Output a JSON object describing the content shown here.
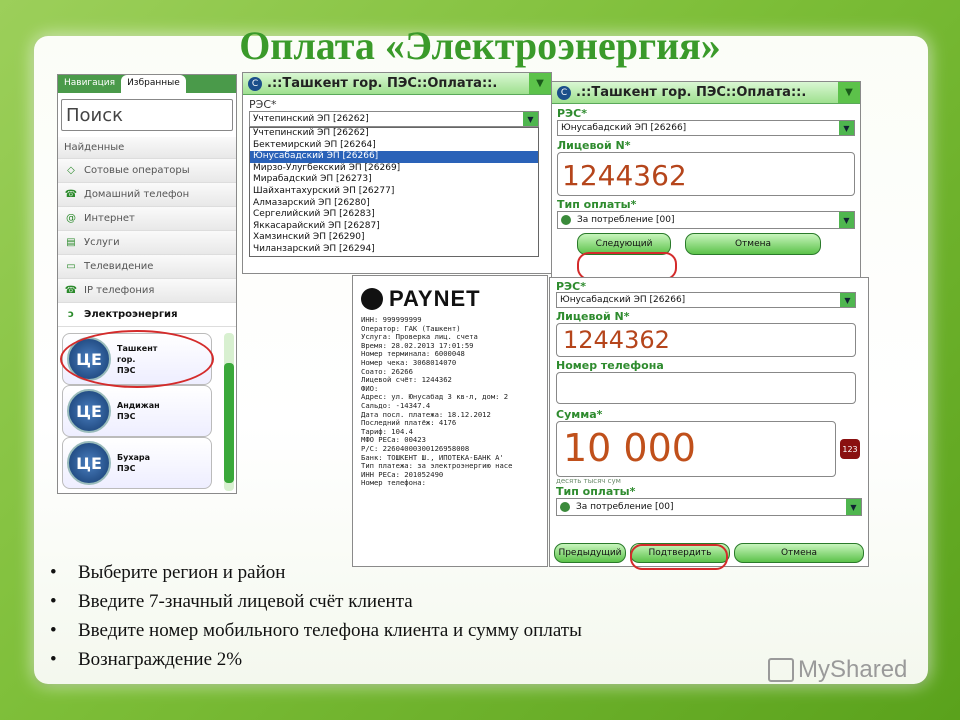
{
  "title": "Оплата «Электроэнергия»",
  "nav": {
    "tab_nav": "Навигация",
    "tab_fav": "Избранные",
    "search_placeholder": "Поиск",
    "found": "Найденные",
    "items": [
      "Сотовые операторы",
      "Домашний телефон",
      "Интернет",
      "Услуги",
      "Телевидение",
      "IP телефония",
      "Электроэнергия"
    ],
    "cards": [
      {
        "line1": "Ташкент",
        "line2": "гор.",
        "line3": "ПЭС"
      },
      {
        "line1": "Андижан",
        "line2": "ПЭС",
        "line3": ""
      },
      {
        "line1": "Бухара",
        "line2": "ПЭС",
        "line3": ""
      }
    ],
    "logo_text": "ЦЕ"
  },
  "dropdown": {
    "header": ".::Ташкент гор. ПЭС::Оплата::.",
    "label": "РЭС*",
    "selected": "Учтепинский ЭП [26262]",
    "options": [
      "Учтепинский ЭП [26262]",
      "Бектемирский ЭП [26264]",
      "Юнусабадский ЭП [26266]",
      "Мирзо-Улугбекский ЭП [26269]",
      "Мирабадский ЭП [26273]",
      "Шайхантахурский ЭП [26277]",
      "Алмазарский ЭП [26280]",
      "Сергелийский ЭП [26283]",
      "Яккасарайский ЭП [26287]",
      "Хамзинский ЭП [26290]",
      "Чиланзарский ЭП [26294]"
    ],
    "highlighted": "Юнусабадский ЭП [26266]"
  },
  "form1": {
    "header": ".::Ташкент гор. ПЭС::Оплата::.",
    "res_label": "РЭС*",
    "res_value": "Юнусабадский ЭП [26266]",
    "account_label": "Лицевой N*",
    "account_value": "1244362",
    "paytype_label": "Тип оплаты*",
    "paytype_value": "За потребление [00]",
    "next_btn": "Следующий",
    "cancel_btn": "Отмена"
  },
  "receipt": {
    "brand": "PAYNET",
    "lines": [
      "ИНН: 999999999",
      "Оператор: ГАК (Ташкент)",
      "Услуга: Проверка лиц. счета",
      "Время: 28.02.2013 17:01:59",
      "Номер терминала: 6000048",
      "Номер чека: 3068014070",
      "Соато: 26266",
      "Лицевой счёт: 1244362",
      "ФИО:",
      "Адрес: ул. Юнусабад 3 кв-л, дом: 2",
      "Сальдо: -14347.4",
      "Дата посл. платежа: 18.12.2012",
      "Последний платёж: 4176",
      "Тариф: 104.4",
      "МФО РЕСа: 00423",
      "Р/С: 22604000300126958008",
      "Банк: ТОШКЕНТ Ш., ИПОТЕКА-БАНК А'",
      "Тип платежа: за электроэнергию насе",
      "ИНН РЕСа: 201052490",
      "Номер телефона:"
    ]
  },
  "form2": {
    "res_label": "РЭС*",
    "res_value": "Юнусабадский ЭП [26266]",
    "account_label": "Лицевой N*",
    "account_value": "1244362",
    "phone_label": "Номер телефона",
    "sum_label": "Сумма*",
    "sum_value": "10 000",
    "sum_words": "десять тысяч сум",
    "paytype_label": "Тип оплаты*",
    "paytype_value": "За потребление [00]",
    "prev_btn": "Предыдущий",
    "confirm_btn": "Подтвердить",
    "cancel_btn": "Отмена",
    "keypad_icon": "keypad-icon"
  },
  "bullets": [
    "Выберите регион и район",
    "Введите 7-значный лицевой счёт клиента",
    "Введите номер мобильного телефона клиента и сумму оплаты",
    "Вознаграждение 2%"
  ],
  "watermark": "MyShared",
  "colors": {
    "title": "#3a9a2a",
    "highlight": "#d42b2b",
    "accent": "#5cc24a"
  }
}
